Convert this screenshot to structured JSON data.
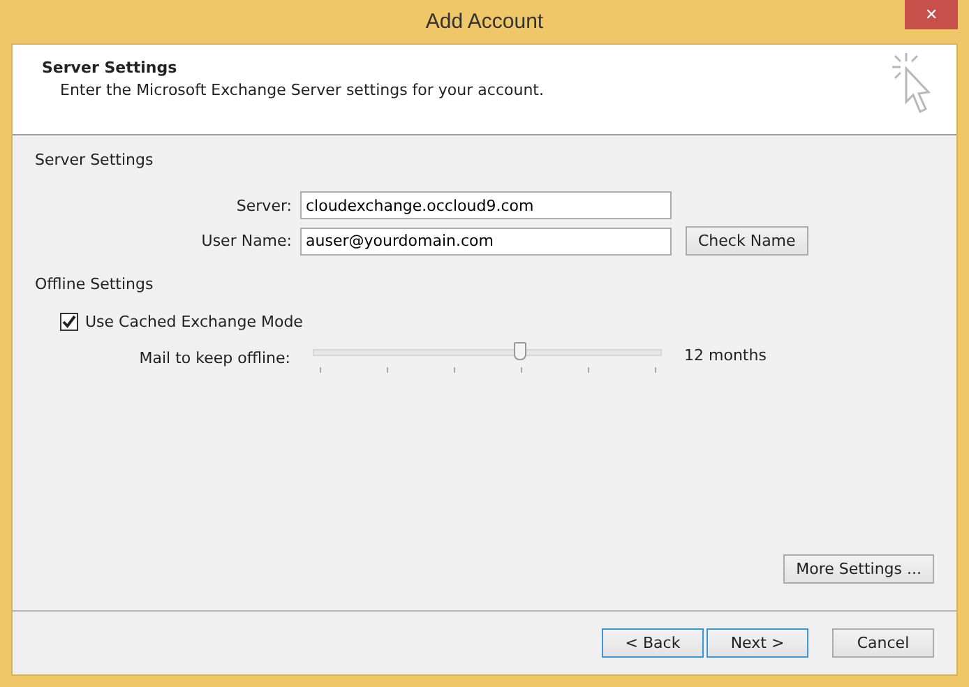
{
  "window": {
    "title": "Add Account",
    "close": "✕"
  },
  "header": {
    "title": "Server Settings",
    "subtitle": "Enter the Microsoft Exchange Server settings for your account."
  },
  "server_settings": {
    "heading": "Server Settings",
    "fields": [
      {
        "label": "Server:",
        "value": "cloudexchange.occloud9.com"
      },
      {
        "label": "User Name:",
        "value": "auser@yourdomain.com"
      }
    ],
    "check_name_button": "Check Name"
  },
  "offline_settings": {
    "heading": "Offline Settings",
    "cached_mode": {
      "label": "Use Cached Exchange Mode",
      "checked": true
    },
    "mail_offline": {
      "label": "Mail to keep offline:",
      "level": 0.6,
      "reading": "12 months"
    }
  },
  "more_settings_button": "More Settings ...",
  "buttons": [
    {
      "label": "< Back",
      "focused": true
    },
    {
      "label": "Next >",
      "focused": true
    },
    {
      "label": "Cancel",
      "focused": false
    }
  ]
}
